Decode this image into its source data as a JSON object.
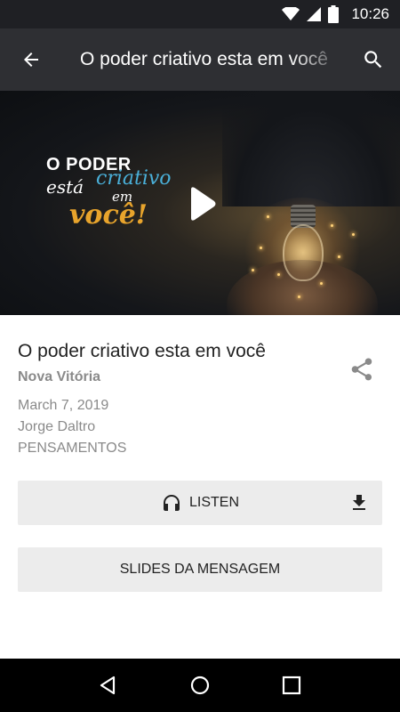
{
  "status_bar": {
    "time": "10:26",
    "icons": [
      "wifi-icon",
      "signal-icon",
      "battery-icon"
    ]
  },
  "app_bar": {
    "title": "O poder criativo esta em você",
    "icons": [
      "back-arrow-icon",
      "search-icon"
    ]
  },
  "hero": {
    "line1": "O PODER",
    "esta": "está",
    "criativo": "criativo",
    "em": "em",
    "voce": "você!",
    "play_icon": "play-icon"
  },
  "details": {
    "title": "O poder criativo esta em você",
    "church": "Nova Vitória",
    "date": "March 7, 2019",
    "speaker": "Jorge Daltro",
    "series": "PENSAMENTOS",
    "share_icon": "share-icon"
  },
  "actions": {
    "listen_label": "LISTEN",
    "listen_icon": "headphones-icon",
    "download_icon": "download-icon",
    "slides_label": "SLIDES DA MENSAGEM"
  },
  "nav_bar": {
    "icons": [
      "nav-back-icon",
      "nav-home-icon",
      "nav-recents-icon"
    ]
  },
  "colors": {
    "status_bar": "#1f2024",
    "app_bar": "#2e2f33",
    "button_bg": "#ececec",
    "muted_text": "#8a8a8a",
    "accent_blue": "#4ab0d9",
    "accent_gold": "#e8a42c"
  }
}
